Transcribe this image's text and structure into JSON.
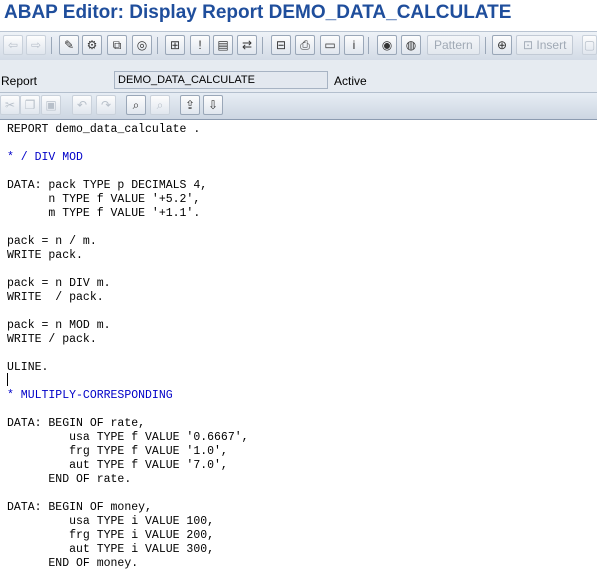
{
  "window": {
    "title": "ABAP Editor: Display Report DEMO_DATA_CALCULATE"
  },
  "toolbar": {
    "items": [
      {
        "name": "back-arrow-icon",
        "glyph": "⇦",
        "disabled": true
      },
      {
        "name": "forward-arrow-icon",
        "glyph": "⇨",
        "disabled": true
      },
      {
        "name": "display-change-icon",
        "glyph": "✎",
        "disabled": false
      },
      {
        "name": "active-inactive-icon",
        "glyph": "⚙",
        "disabled": false
      },
      {
        "name": "other-object-icon",
        "glyph": "⧉",
        "disabled": false
      },
      {
        "name": "check-icon",
        "glyph": "◎",
        "disabled": false
      },
      {
        "name": "where-used-icon",
        "glyph": "⊞",
        "disabled": false
      },
      {
        "name": "activate-icon",
        "glyph": "!",
        "disabled": false
      },
      {
        "name": "test-icon",
        "glyph": "▤",
        "disabled": false
      },
      {
        "name": "navigate-icon",
        "glyph": "⇄",
        "disabled": false
      },
      {
        "name": "object-list-icon",
        "glyph": "⊟",
        "disabled": false
      },
      {
        "name": "print-icon",
        "glyph": "⎙",
        "disabled": false
      },
      {
        "name": "display-object-icon",
        "glyph": "▭",
        "disabled": false
      },
      {
        "name": "info-icon",
        "glyph": "i",
        "disabled": false
      },
      {
        "name": "breakpoint-icon",
        "glyph": "◉",
        "disabled": false
      },
      {
        "name": "stop-icon",
        "glyph": "◍",
        "disabled": false
      }
    ],
    "pattern_label": "Pattern",
    "insert_label": "Insert"
  },
  "report": {
    "label": "Report",
    "value": "DEMO_DATA_CALCULATE",
    "status": "Active"
  },
  "edit_toolbar": {
    "items": [
      {
        "name": "cut-icon",
        "glyph": "✂",
        "disabled": true
      },
      {
        "name": "copy-icon",
        "glyph": "❐",
        "disabled": true
      },
      {
        "name": "paste-icon",
        "glyph": "▣",
        "disabled": true
      },
      {
        "name": "undo-icon",
        "glyph": "↶",
        "disabled": true
      },
      {
        "name": "redo-icon",
        "glyph": "↷",
        "disabled": true
      },
      {
        "name": "find-icon",
        "glyph": "⌕",
        "disabled": false
      },
      {
        "name": "find-next-icon",
        "glyph": "⌕",
        "disabled": true
      },
      {
        "name": "upload-icon",
        "glyph": "⇪",
        "disabled": false
      },
      {
        "name": "download-icon",
        "glyph": "⇩",
        "disabled": false
      }
    ]
  },
  "code": {
    "lines": [
      {
        "text": "REPORT demo_data_calculate .",
        "type": "code"
      },
      {
        "text": "",
        "type": "code"
      },
      {
        "text": "* / DIV MOD",
        "type": "comment"
      },
      {
        "text": "",
        "type": "code"
      },
      {
        "text": "DATA: pack TYPE p DECIMALS 4,",
        "type": "code"
      },
      {
        "text": "      n TYPE f VALUE '+5.2',",
        "type": "code"
      },
      {
        "text": "      m TYPE f VALUE '+1.1'.",
        "type": "code"
      },
      {
        "text": "",
        "type": "code"
      },
      {
        "text": "pack = n / m.",
        "type": "code"
      },
      {
        "text": "WRITE pack.",
        "type": "code"
      },
      {
        "text": "",
        "type": "code"
      },
      {
        "text": "pack = n DIV m.",
        "type": "code"
      },
      {
        "text": "WRITE  / pack.",
        "type": "code"
      },
      {
        "text": "",
        "type": "code"
      },
      {
        "text": "pack = n MOD m.",
        "type": "code"
      },
      {
        "text": "WRITE / pack.",
        "type": "code"
      },
      {
        "text": "",
        "type": "code"
      },
      {
        "text": "ULINE.",
        "type": "code"
      },
      {
        "text": "",
        "type": "code"
      },
      {
        "text": "* MULTIPLY-CORRESPONDING",
        "type": "comment"
      },
      {
        "text": "",
        "type": "code"
      },
      {
        "text": "DATA: BEGIN OF rate,",
        "type": "code"
      },
      {
        "text": "         usa TYPE f VALUE '0.6667',",
        "type": "code"
      },
      {
        "text": "         frg TYPE f VALUE '1.0',",
        "type": "code"
      },
      {
        "text": "         aut TYPE f VALUE '7.0',",
        "type": "code"
      },
      {
        "text": "      END OF rate.",
        "type": "code"
      },
      {
        "text": "",
        "type": "code"
      },
      {
        "text": "DATA: BEGIN OF money,",
        "type": "code"
      },
      {
        "text": "         usa TYPE i VALUE 100,",
        "type": "code"
      },
      {
        "text": "         frg TYPE i VALUE 200,",
        "type": "code"
      },
      {
        "text": "         aut TYPE i VALUE 300,",
        "type": "code"
      },
      {
        "text": "      END OF money.",
        "type": "code"
      }
    ]
  }
}
